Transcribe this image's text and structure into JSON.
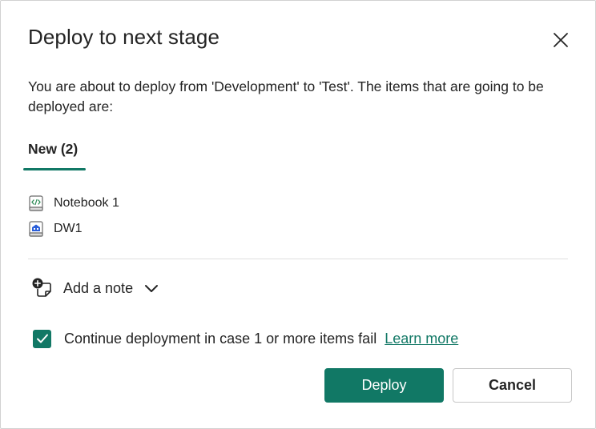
{
  "dialog": {
    "title": "Deploy to next stage",
    "description": "You are about to deploy from 'Development' to 'Test'. The items that are going to be deployed are:"
  },
  "tabs": [
    {
      "label": "New (2)",
      "selected": true
    }
  ],
  "items": [
    {
      "label": "Notebook 1",
      "icon": "notebook-icon"
    },
    {
      "label": "DW1",
      "icon": "warehouse-icon"
    }
  ],
  "note": {
    "label": "Add a note",
    "icon": "add-note-icon"
  },
  "option": {
    "checked": true,
    "label": "Continue deployment in case 1 or more items fail",
    "link": "Learn more"
  },
  "buttons": {
    "primary": "Deploy",
    "secondary": "Cancel"
  },
  "colors": {
    "accent": "#117865",
    "text": "#242424",
    "divider": "#e0e0e0"
  }
}
